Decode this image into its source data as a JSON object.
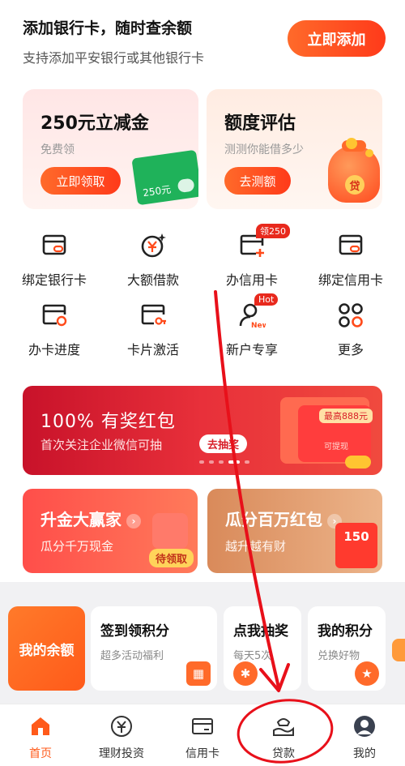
{
  "top": {
    "title": "添加银行卡，随时查余额",
    "subtitle": "支持添加平安银行或其他银行卡",
    "add_button": "立即添加"
  },
  "cards": [
    {
      "title": "250元立减金",
      "subtitle": "免费领",
      "button": "立即领取",
      "coupon_amount": "250元"
    },
    {
      "title": "额度评估",
      "subtitle": "测测你能借多少",
      "button": "去测额",
      "bag_label": "贷"
    }
  ],
  "grid": [
    {
      "label": "绑定银行卡",
      "icon": "bind-card-icon"
    },
    {
      "label": "大额借款",
      "icon": "yuan-loan-icon"
    },
    {
      "label": "办信用卡",
      "icon": "apply-card-icon",
      "badge": "领250"
    },
    {
      "label": "绑定信用卡",
      "icon": "bind-credit-card-icon"
    },
    {
      "label": "办卡进度",
      "icon": "card-progress-icon"
    },
    {
      "label": "卡片激活",
      "icon": "card-activate-icon"
    },
    {
      "label": "新户专享",
      "icon": "new-user-icon",
      "badge": "Hot",
      "icon_text": "New"
    },
    {
      "label": "更多",
      "icon": "more-icon"
    }
  ],
  "banner": {
    "title": "100% 有奖红包",
    "subtitle": "首次关注企业微信可抽",
    "pill": "去抽奖",
    "tag": "最高888元",
    "note": "可提现"
  },
  "promos": [
    {
      "title": "升金大赢家",
      "subtitle": "瓜分千万现金",
      "pill": "待领取"
    },
    {
      "title": "瓜分百万红包",
      "subtitle": "越升越有财",
      "amount": "150"
    }
  ],
  "strip": {
    "balance": "我的余额",
    "tiles": [
      {
        "title": "签到领积分",
        "subtitle": "超多活动福利",
        "icon": "calendar-icon"
      },
      {
        "title": "点我抽奖",
        "subtitle": "每天5次",
        "icon": "wheel-icon"
      },
      {
        "title": "我的积分",
        "subtitle": "兑换好物",
        "icon": "star-icon"
      }
    ]
  },
  "tabs": [
    {
      "label": "首页",
      "icon": "home-icon",
      "active": true
    },
    {
      "label": "理财投资",
      "icon": "wealth-icon"
    },
    {
      "label": "信用卡",
      "icon": "credit-card-icon"
    },
    {
      "label": "贷款",
      "icon": "loan-icon"
    },
    {
      "label": "我的",
      "icon": "profile-icon"
    }
  ],
  "colors": {
    "accent": "#ff5a1a",
    "annotation": "#e8101a"
  }
}
